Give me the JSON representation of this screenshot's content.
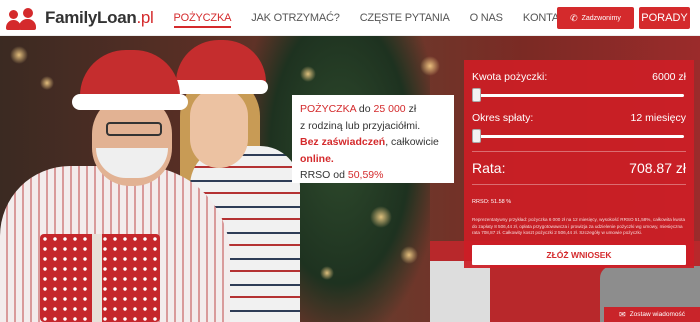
{
  "brand": {
    "name": "FamilyLoan",
    "tld": ".pl",
    "accent_color": "#d42a2c"
  },
  "nav": {
    "items": [
      {
        "label": "POŻYCZKA",
        "active": true
      },
      {
        "label": "JAK OTRZYMAĆ?",
        "active": false
      },
      {
        "label": "CZĘSTE PYTANIA",
        "active": false
      },
      {
        "label": "O NAS",
        "active": false
      },
      {
        "label": "KONTAKT",
        "active": false
      }
    ]
  },
  "header_buttons": {
    "call_label": "Zadzwonimy",
    "call_icon": "phone-icon",
    "porady_label": "PORADY"
  },
  "promo": {
    "l1_prefix": "POŻYCZKA",
    "l1_mid": " do ",
    "l1_amount": "25 000",
    "l1_suffix": " zł",
    "l2": "z rodziną lub przyjaciółmi.",
    "l3_bold": "Bez zaświadczeń",
    "l3_mid": ", całkowicie ",
    "l3_online": "online.",
    "l4_prefix": "RRSO od ",
    "l4_value": "50,59%"
  },
  "calculator": {
    "amount_label": "Kwota pożyczki:",
    "amount_value": "6000 zł",
    "amount_slider_fraction": 0.0,
    "period_label": "Okres spłaty:",
    "period_value": "12 miesięcy",
    "period_slider_fraction": 0.0,
    "rate_label": "Rata:",
    "rate_value": "708.87 zł",
    "rrso_text": "RRSO: 51.58 %",
    "legal_text": "Reprezentatywny przykład: pożyczka 6 000 zł na 12 miesięcy, wysokość RRSO 51,58%, całkowita kwota do zapłaty 8 506,44 zł, opłata przygotowawcza i prowizja za udzielenie pożyczki wg umowy, miesięczna rata 708,87 zł. Całkowity koszt pożyczki 2 506,44 zł. Szczegóły w umowie pożyczki.",
    "apply_label": "ZŁÓŻ WNIOSEK"
  },
  "chat": {
    "label": "Zostaw wiadomość",
    "icon": "envelope-icon"
  }
}
